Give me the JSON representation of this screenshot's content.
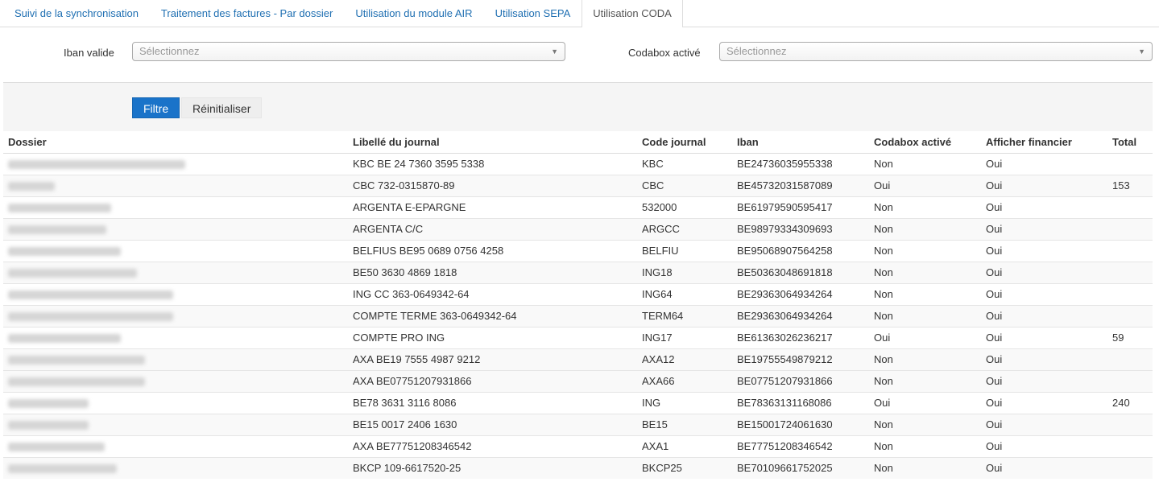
{
  "tabs": [
    {
      "label": "Suivi de la synchronisation",
      "active": false
    },
    {
      "label": "Traitement des factures - Par dossier",
      "active": false
    },
    {
      "label": "Utilisation du module AIR",
      "active": false
    },
    {
      "label": "Utilisation SEPA",
      "active": false
    },
    {
      "label": "Utilisation CODA",
      "active": true
    }
  ],
  "filters": {
    "iban_label": "Iban valide",
    "iban_placeholder": "Sélectionnez",
    "codabox_label": "Codabox activé",
    "codabox_placeholder": "Sélectionnez"
  },
  "buttons": {
    "filter": "Filtre",
    "reset": "Réinitialiser"
  },
  "colors": {
    "link": "#1f6fb2",
    "primary_button": "#1a73c9"
  },
  "table": {
    "columns": [
      "Dossier",
      "Libellé du journal",
      "Code journal",
      "Iban",
      "Codabox activé",
      "Afficher financier",
      "Total"
    ],
    "rows": [
      {
        "journal": "KBC BE 24 7360 3595 5338",
        "code": "KBC",
        "iban": "BE24736035955338",
        "codabox": "Non",
        "financier": "Oui",
        "total": ""
      },
      {
        "journal": "CBC 732-0315870-89",
        "code": "CBC",
        "iban": "BE45732031587089",
        "codabox": "Oui",
        "financier": "Oui",
        "total": "153"
      },
      {
        "journal": "ARGENTA E-EPARGNE",
        "code": "532000",
        "iban": "BE61979590595417",
        "codabox": "Non",
        "financier": "Oui",
        "total": ""
      },
      {
        "journal": "ARGENTA C/C",
        "code": "ARGCC",
        "iban": "BE98979334309693",
        "codabox": "Non",
        "financier": "Oui",
        "total": ""
      },
      {
        "journal": "BELFIUS BE95 0689 0756 4258",
        "code": "BELFIU",
        "iban": "BE95068907564258",
        "codabox": "Non",
        "financier": "Oui",
        "total": ""
      },
      {
        "journal": "BE50 3630 4869 1818",
        "code": "ING18",
        "iban": "BE50363048691818",
        "codabox": "Non",
        "financier": "Oui",
        "total": ""
      },
      {
        "journal": "ING CC 363-0649342-64",
        "code": "ING64",
        "iban": "BE29363064934264",
        "codabox": "Non",
        "financier": "Oui",
        "total": ""
      },
      {
        "journal": "COMPTE TERME 363-0649342-64",
        "code": "TERM64",
        "iban": "BE29363064934264",
        "codabox": "Non",
        "financier": "Oui",
        "total": ""
      },
      {
        "journal": "COMPTE PRO ING",
        "code": "ING17",
        "iban": "BE61363026236217",
        "codabox": "Oui",
        "financier": "Oui",
        "total": "59"
      },
      {
        "journal": "AXA BE19 7555 4987 9212",
        "code": "AXA12",
        "iban": "BE19755549879212",
        "codabox": "Non",
        "financier": "Oui",
        "total": ""
      },
      {
        "journal": "AXA BE07751207931866",
        "code": "AXA66",
        "iban": "BE07751207931866",
        "codabox": "Non",
        "financier": "Oui",
        "total": ""
      },
      {
        "journal": "BE78 3631 3116 8086",
        "code": "ING",
        "iban": "BE78363131168086",
        "codabox": "Oui",
        "financier": "Oui",
        "total": "240"
      },
      {
        "journal": "BE15 0017 2406 1630",
        "code": "BE15",
        "iban": "BE15001724061630",
        "codabox": "Non",
        "financier": "Oui",
        "total": ""
      },
      {
        "journal": "AXA BE77751208346542",
        "code": "AXA1",
        "iban": "BE77751208346542",
        "codabox": "Non",
        "financier": "Oui",
        "total": ""
      },
      {
        "journal": "BKCP 109-6617520-25",
        "code": "BKCP25",
        "iban": "BE70109661752025",
        "codabox": "Non",
        "financier": "Oui",
        "total": ""
      }
    ]
  }
}
